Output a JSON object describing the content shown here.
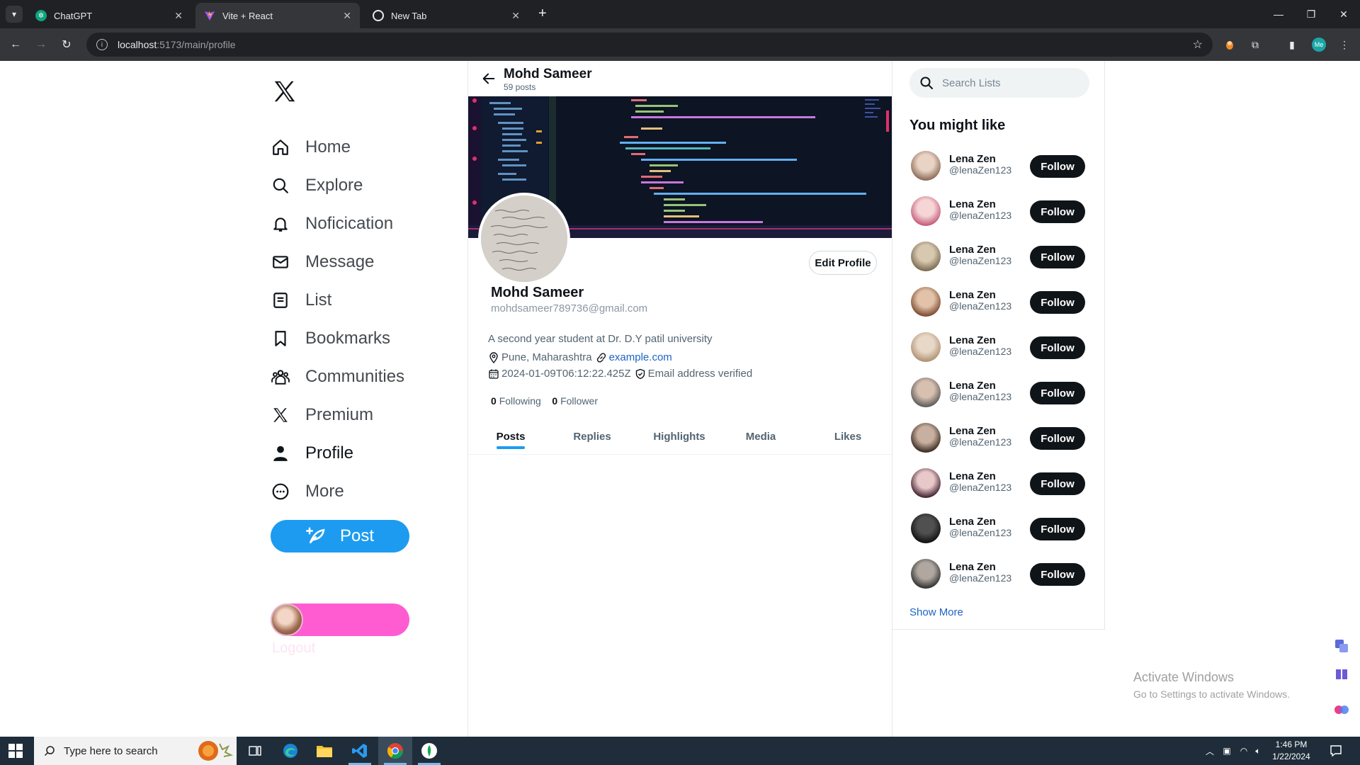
{
  "browser": {
    "tabs": [
      {
        "title": "ChatGPT",
        "active": false
      },
      {
        "title": "Vite + React",
        "active": true
      },
      {
        "title": "New Tab",
        "active": false
      }
    ],
    "url_host": "localhost",
    "url_path": ":5173/main/profile",
    "profile_badge": "Me"
  },
  "nav": {
    "items": [
      {
        "label": "Home",
        "icon": "home-icon"
      },
      {
        "label": "Explore",
        "icon": "search-icon"
      },
      {
        "label": "Noficication",
        "icon": "bell-icon"
      },
      {
        "label": "Message",
        "icon": "mail-icon"
      },
      {
        "label": "List",
        "icon": "list-icon"
      },
      {
        "label": "Bookmarks",
        "icon": "bookmark-icon"
      },
      {
        "label": "Communities",
        "icon": "communities-icon"
      },
      {
        "label": "Premium",
        "icon": "x-logo-icon"
      },
      {
        "label": "Profile",
        "icon": "person-icon"
      },
      {
        "label": "More",
        "icon": "more-icon"
      }
    ],
    "post_label": "Post",
    "logout_label": "Logout"
  },
  "profile": {
    "header_name": "Mohd Sameer",
    "post_count": "59 posts",
    "edit_label": "Edit Profile",
    "name": "Mohd Sameer",
    "email": "mohdsameer789736@gmail.com",
    "bio": "A second year student at Dr. D.Y patil university",
    "location": "Pune, Maharashtra",
    "website": "example.com",
    "joined": "2024-01-09T06:12:22.425Z",
    "verified": "Email address verified",
    "following_count": "0",
    "following_label": "Following",
    "follower_count": "0",
    "follower_label": "Follower",
    "tabs": [
      "Posts",
      "Replies",
      "Highlights",
      "Media",
      "Likes"
    ],
    "active_tab": "Posts"
  },
  "sidebar": {
    "search_placeholder": "Search Lists",
    "title": "You might like",
    "suggestions": [
      {
        "name": "Lena Zen",
        "handle": "@lenaZen123",
        "button": "Follow"
      },
      {
        "name": "Lena Zen",
        "handle": "@lenaZen123",
        "button": "Follow"
      },
      {
        "name": "Lena Zen",
        "handle": "@lenaZen123",
        "button": "Follow"
      },
      {
        "name": "Lena Zen",
        "handle": "@lenaZen123",
        "button": "Follow"
      },
      {
        "name": "Lena Zen",
        "handle": "@lenaZen123",
        "button": "Follow"
      },
      {
        "name": "Lena Zen",
        "handle": "@lenaZen123",
        "button": "Follow"
      },
      {
        "name": "Lena Zen",
        "handle": "@lenaZen123",
        "button": "Follow"
      },
      {
        "name": "Lena Zen",
        "handle": "@lenaZen123",
        "button": "Follow"
      },
      {
        "name": "Lena Zen",
        "handle": "@lenaZen123",
        "button": "Follow"
      },
      {
        "name": "Lena Zen",
        "handle": "@lenaZen123",
        "button": "Follow"
      }
    ],
    "show_more": "Show More"
  },
  "watermark": {
    "title": "Activate Windows",
    "subtitle": "Go to Settings to activate Windows."
  },
  "taskbar": {
    "search_placeholder": "Type here to search",
    "time": "1:46 PM",
    "date": "1/22/2024"
  },
  "colors": {
    "accent": "#1d9bf0",
    "pill": "#ff5cd1",
    "follow_button": "#0f1419",
    "link": "#1d64c4"
  }
}
